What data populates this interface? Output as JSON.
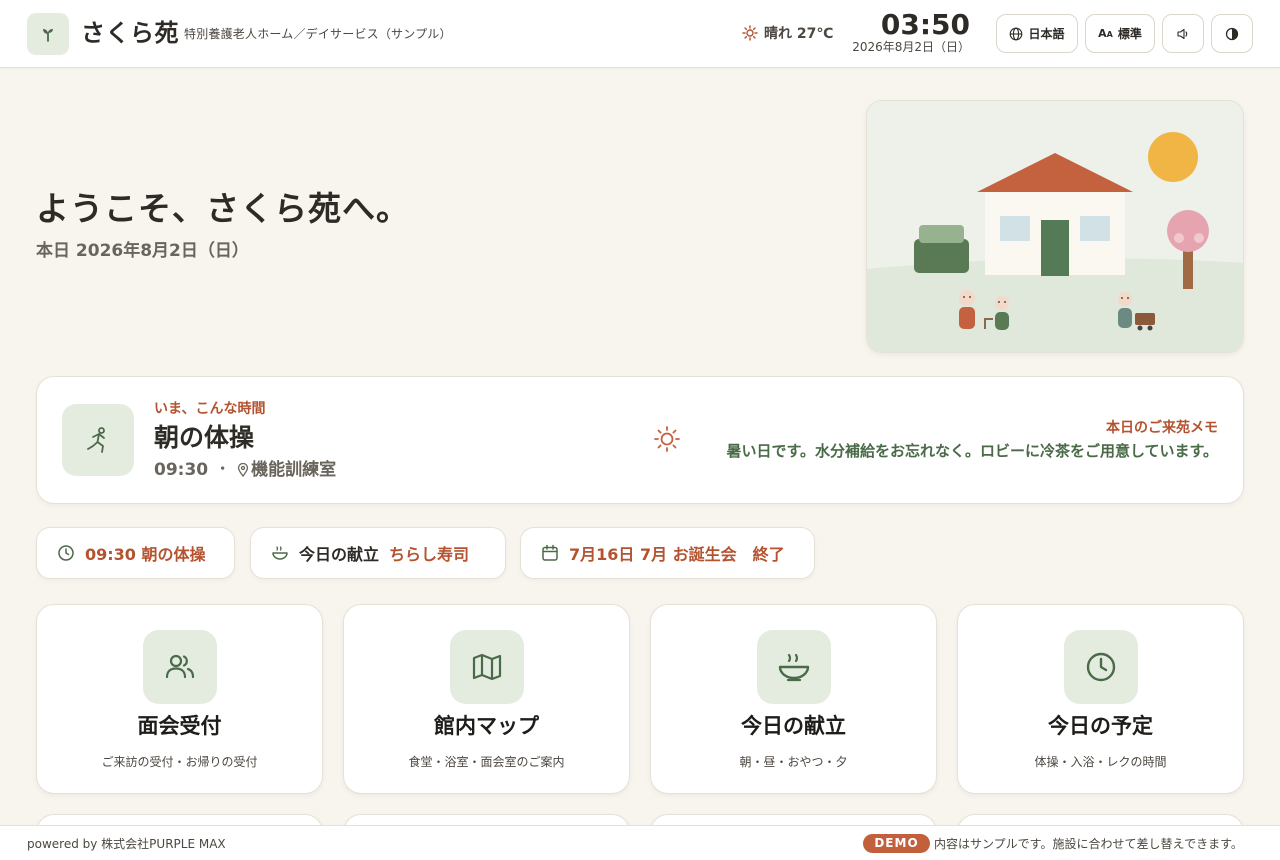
{
  "header": {
    "brand_name": "さくら苑",
    "brand_subtitle": "特別養護老人ホーム／デイサービス（サンプル）",
    "weather": "晴れ 27℃",
    "time": "03:50",
    "date": "2026年8月2日（日）",
    "buttons": {
      "language": "日本語",
      "text_size": "標準"
    },
    "icons": {
      "logo": "sprout-icon",
      "weather": "sun-icon",
      "language": "globe-icon",
      "text_size": "font-size-icon",
      "sound": "speaker-icon",
      "contrast": "contrast-icon"
    }
  },
  "hero": {
    "greeting": "ようこそ、さくら苑へ。",
    "today": "本日 2026年8月2日（日）"
  },
  "now": {
    "label": "いま、こんな時間",
    "title": "朝の体操",
    "time": "09:30",
    "separator": "・",
    "place": "機能訓練室",
    "memo_label": "本日のご来苑メモ",
    "memo_text": "暑い日です。水分補給をお忘れなく。ロビーに冷茶をご用意しています。"
  },
  "chips": [
    {
      "icon": "clock-icon",
      "text": "09:30 朝の体操"
    },
    {
      "icon": "bowl-icon",
      "label": "今日の献立",
      "value": "ちらし寿司"
    },
    {
      "icon": "calendar-icon",
      "text": "7月16日 7月 お誕生会　終了"
    }
  ],
  "tiles": [
    {
      "icon": "people-icon",
      "title": "面会受付",
      "subtitle": "ご来訪の受付・お帰りの受付"
    },
    {
      "icon": "map-icon",
      "title": "館内マップ",
      "subtitle": "食堂・浴室・面会室のご案内"
    },
    {
      "icon": "bowl-icon",
      "title": "今日の献立",
      "subtitle": "朝・昼・おやつ・夕"
    },
    {
      "icon": "clock-icon",
      "title": "今日の予定",
      "subtitle": "体操・入浴・レクの時間"
    }
  ],
  "footer": {
    "powered_by": "powered by 株式会社PURPLE MAX",
    "badge": "DEMO",
    "note": "内容はサンプルです。施設に合わせて差し替えできます。"
  },
  "colors": {
    "background": "#f8f5ef",
    "accent_terracotta": "#b4532f",
    "accent_green": "#4a6a48",
    "icon_bg": "#e4ece0",
    "badge": "#c2603d"
  }
}
